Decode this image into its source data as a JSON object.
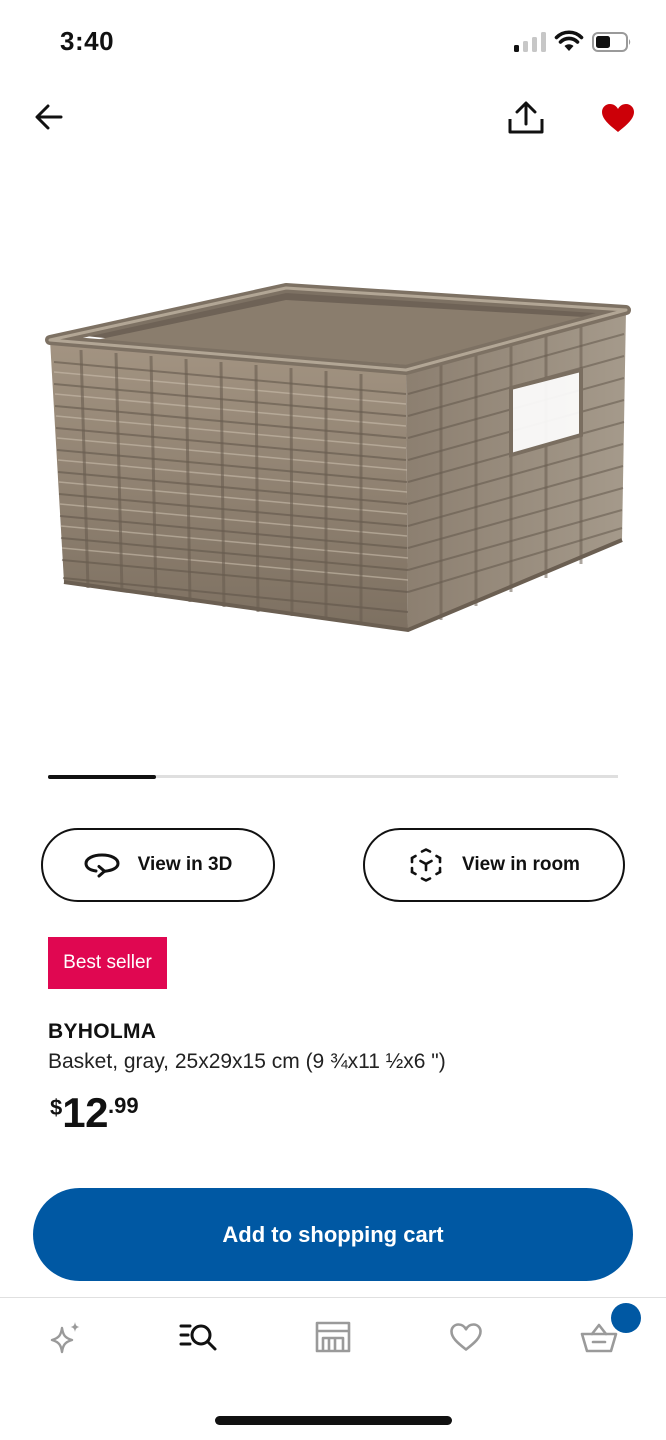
{
  "status_bar": {
    "time": "3:40",
    "icons": [
      "cellular-signal-icon",
      "wifi-icon",
      "battery-icon"
    ]
  },
  "top_nav": {
    "back_icon": "arrow-left-icon",
    "share_icon": "share-upload-icon",
    "favorite_icon": "heart-filled-icon",
    "favorite_color": "#cc0008"
  },
  "product_image": {
    "subject": "wicker-basket",
    "carousel_progress": 0.19
  },
  "actions": {
    "view_3d_label": "View in 3D",
    "view_3d_icon": "rotate-3d-icon",
    "view_room_label": "View in room",
    "view_room_icon": "ar-cube-icon"
  },
  "product": {
    "badge": "Best seller",
    "badge_color": "#e00751",
    "name": "BYHOLMA",
    "description": "Basket, gray, 25x29x15 cm (9 ¾x11 ½x6 \")",
    "price_currency": "$",
    "price_integer": "12",
    "price_decimal": ".99"
  },
  "cta": {
    "label": "Add to shopping cart",
    "color": "#0058a3"
  },
  "tab_bar": {
    "tabs": [
      {
        "name": "sparkle-icon"
      },
      {
        "name": "search-list-icon",
        "active": true
      },
      {
        "name": "store-icon"
      },
      {
        "name": "heart-outline-icon"
      },
      {
        "name": "basket-icon",
        "has_badge": true
      }
    ]
  }
}
